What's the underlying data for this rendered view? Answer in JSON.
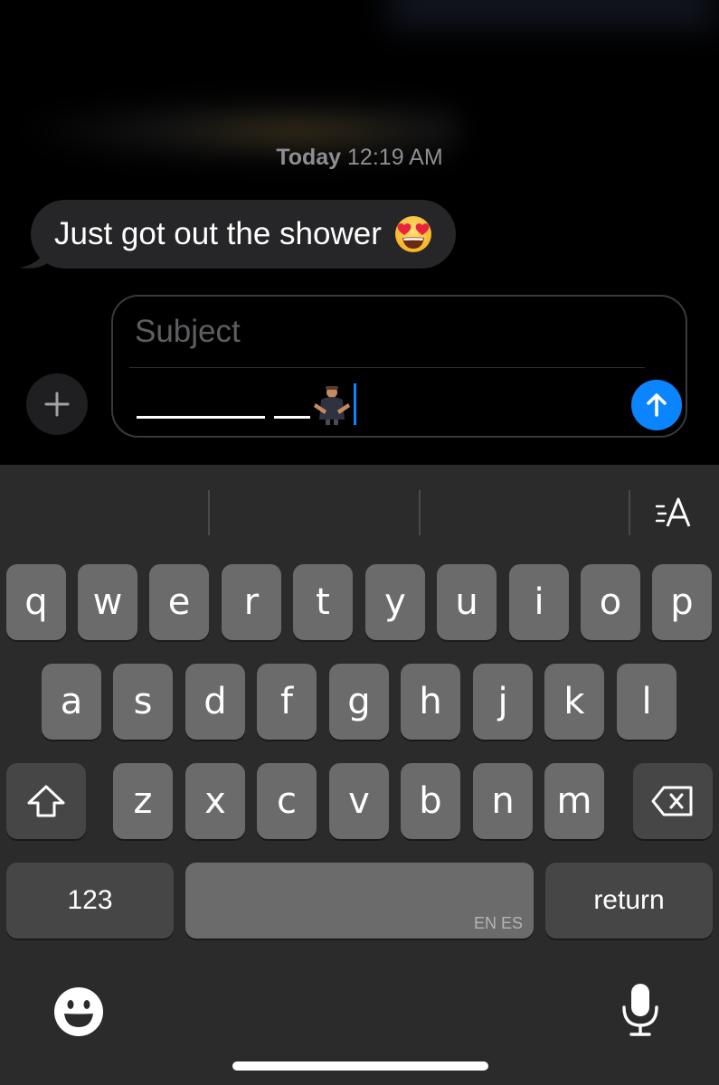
{
  "thread": {
    "timestamp_day": "Today",
    "timestamp_time": "12:19 AM",
    "messages": [
      {
        "direction": "incoming",
        "text": "Just got out the shower",
        "emoji": "smiling-face-with-heart-eyes-icon"
      }
    ]
  },
  "composer": {
    "subject_placeholder": "Subject",
    "subject_value": "",
    "message_value": "________ __"
  },
  "keyboard": {
    "row1": [
      "q",
      "w",
      "e",
      "r",
      "t",
      "y",
      "u",
      "i",
      "o",
      "p"
    ],
    "row2": [
      "a",
      "s",
      "d",
      "f",
      "g",
      "h",
      "j",
      "k",
      "l"
    ],
    "row3": [
      "z",
      "x",
      "c",
      "v",
      "b",
      "n",
      "m"
    ],
    "numbers_label": "123",
    "space_languages": "EN ES",
    "return_label": "return"
  },
  "colors": {
    "accent": "#0a84ff",
    "bubble_incoming": "#262628",
    "key": "#6b6b6b",
    "key_dark": "#464646",
    "keyboard_bg": "#2b2b2b"
  }
}
